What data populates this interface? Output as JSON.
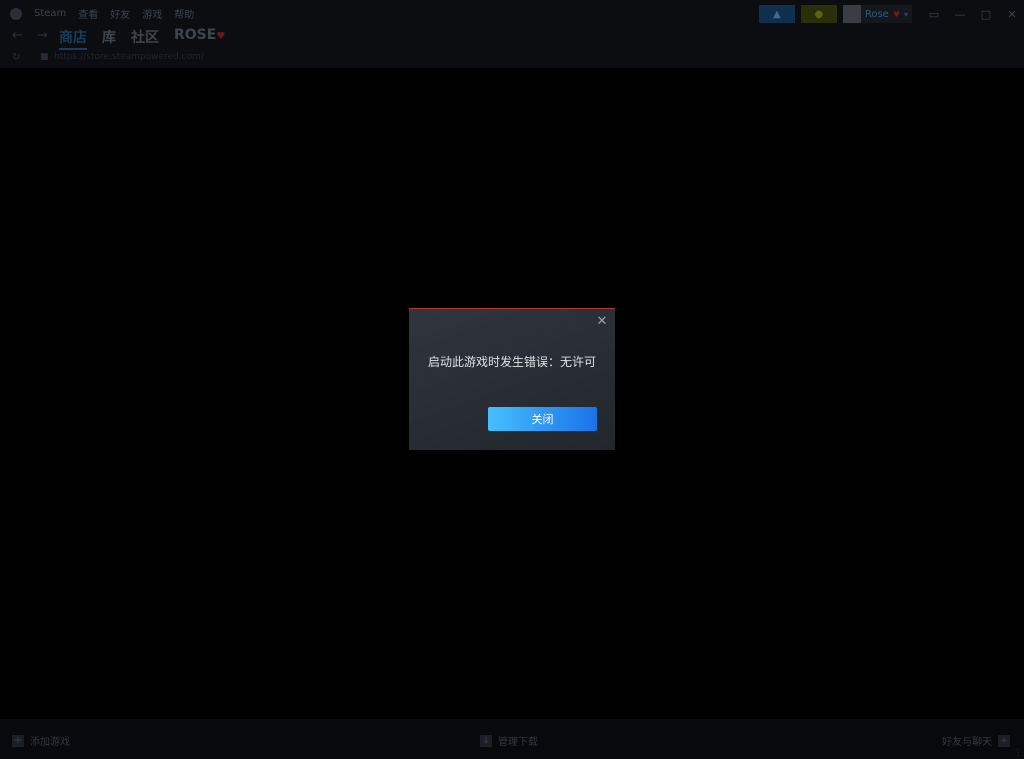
{
  "menubar": {
    "app_name": "Steam",
    "items": [
      "查看",
      "好友",
      "游戏",
      "帮助"
    ],
    "user_name": "Rose",
    "announce_icon": "megaphone-icon",
    "notify_icon": "bell-icon"
  },
  "nav": {
    "back_glyph": "←",
    "forward_glyph": "→",
    "tabs": [
      "商店",
      "库",
      "社区",
      "ROSE"
    ],
    "active_tab": "商店"
  },
  "url": {
    "text": "https://store.steampowered.com/"
  },
  "dialog": {
    "message": "启动此游戏时发生错误：无许可",
    "close_button_label": "关闭",
    "close_glyph": "✕"
  },
  "bottombar": {
    "add_game_label": "添加游戏",
    "downloads_label": "管理下载",
    "friends_label": "好友与聊天"
  },
  "colors": {
    "accent_blue": "#1a73e8",
    "accent_blue_light": "#47bfff",
    "dialog_top_border": "#b23a2b"
  }
}
